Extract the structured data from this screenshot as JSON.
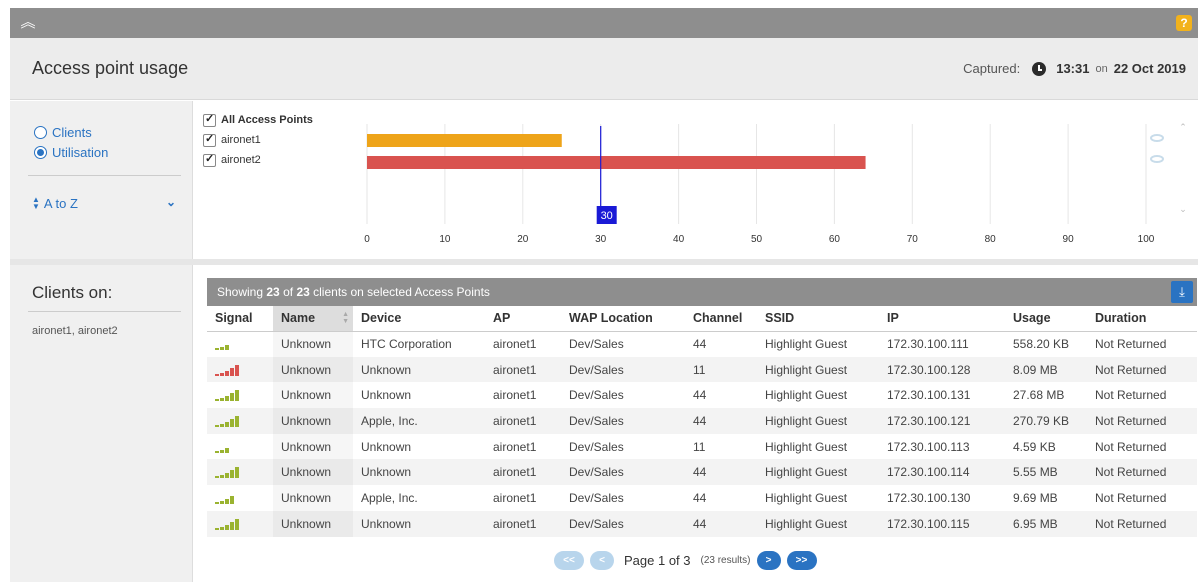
{
  "header": {
    "title": "Access point usage",
    "captured_label": "Captured:",
    "captured_time": "13:31",
    "captured_on": "on",
    "captured_date": "22 Oct 2019"
  },
  "sidebar": {
    "view_options": [
      {
        "label": "Clients",
        "selected": false
      },
      {
        "label": "Utilisation",
        "selected": true
      }
    ],
    "sort_label": "A to Z",
    "clients_on_title": "Clients on:",
    "clients_on_list": "aironet1, aironet2"
  },
  "access_points": {
    "all_label": "All Access Points",
    "items": [
      {
        "label": "aironet1",
        "checked": true
      },
      {
        "label": "aironet2",
        "checked": true
      }
    ]
  },
  "chart_data": {
    "type": "bar",
    "orientation": "horizontal",
    "categories": [
      "aironet1",
      "aironet2"
    ],
    "values": [
      25,
      64
    ],
    "colors": [
      "#eea419",
      "#d9534f"
    ],
    "xlim": [
      0,
      100
    ],
    "xticks": [
      0,
      10,
      20,
      30,
      40,
      50,
      60,
      70,
      80,
      90,
      100
    ],
    "marker": {
      "value": 30,
      "label": "30",
      "color": "#1a1ad6"
    },
    "grid": true
  },
  "table": {
    "summary_prefix": "Showing",
    "shown": "23",
    "summary_of": "of",
    "total": "23",
    "summary_suffix": "clients on selected Access Points",
    "columns": [
      "Signal",
      "Name",
      "Device",
      "AP",
      "WAP Location",
      "Channel",
      "SSID",
      "IP",
      "Usage",
      "Duration"
    ],
    "rows": [
      {
        "signal": 3,
        "name": "Unknown",
        "device": "HTC Corporation",
        "ap": "aironet1",
        "location": "Dev/Sales",
        "channel": "44",
        "ssid": "Highlight Guest",
        "ip": "172.30.100.111",
        "usage": "558.20 KB",
        "duration": "Not Returned"
      },
      {
        "signal": 1,
        "name": "Unknown",
        "device": "Unknown",
        "ap": "aironet1",
        "location": "Dev/Sales",
        "channel": "11",
        "ssid": "Highlight Guest",
        "ip": "172.30.100.128",
        "usage": "8.09 MB",
        "duration": "Not Returned"
      },
      {
        "signal": 5,
        "name": "Unknown",
        "device": "Unknown",
        "ap": "aironet1",
        "location": "Dev/Sales",
        "channel": "44",
        "ssid": "Highlight Guest",
        "ip": "172.30.100.131",
        "usage": "27.68 MB",
        "duration": "Not Returned"
      },
      {
        "signal": 5,
        "name": "Unknown",
        "device": "Apple, Inc.",
        "ap": "aironet1",
        "location": "Dev/Sales",
        "channel": "44",
        "ssid": "Highlight Guest",
        "ip": "172.30.100.121",
        "usage": "270.79 KB",
        "duration": "Not Returned"
      },
      {
        "signal": 3,
        "name": "Unknown",
        "device": "Unknown",
        "ap": "aironet1",
        "location": "Dev/Sales",
        "channel": "11",
        "ssid": "Highlight Guest",
        "ip": "172.30.100.113",
        "usage": "4.59 KB",
        "duration": "Not Returned"
      },
      {
        "signal": 5,
        "name": "Unknown",
        "device": "Unknown",
        "ap": "aironet1",
        "location": "Dev/Sales",
        "channel": "44",
        "ssid": "Highlight Guest",
        "ip": "172.30.100.114",
        "usage": "5.55 MB",
        "duration": "Not Returned"
      },
      {
        "signal": 4,
        "name": "Unknown",
        "device": "Apple, Inc.",
        "ap": "aironet1",
        "location": "Dev/Sales",
        "channel": "44",
        "ssid": "Highlight Guest",
        "ip": "172.30.100.130",
        "usage": "9.69 MB",
        "duration": "Not Returned"
      },
      {
        "signal": 5,
        "name": "Unknown",
        "device": "Unknown",
        "ap": "aironet1",
        "location": "Dev/Sales",
        "channel": "44",
        "ssid": "Highlight Guest",
        "ip": "172.30.100.115",
        "usage": "6.95 MB",
        "duration": "Not Returned"
      }
    ]
  },
  "pagination": {
    "first": "<<",
    "prev": "<",
    "next": ">",
    "last": ">>",
    "page_label": "Page 1 of 3",
    "results": "(23 results)"
  },
  "icons": {
    "collapse": "chevron-double-up-icon",
    "help": "help-icon",
    "clock": "clock-icon",
    "download": "download-icon",
    "eye": "eye-icon"
  },
  "colors": {
    "accent": "#2a73c2",
    "bar_aironet1": "#eea419",
    "bar_aironet2": "#d9534f",
    "signal_good": "#9ab330",
    "signal_poor": "#d9534f"
  }
}
